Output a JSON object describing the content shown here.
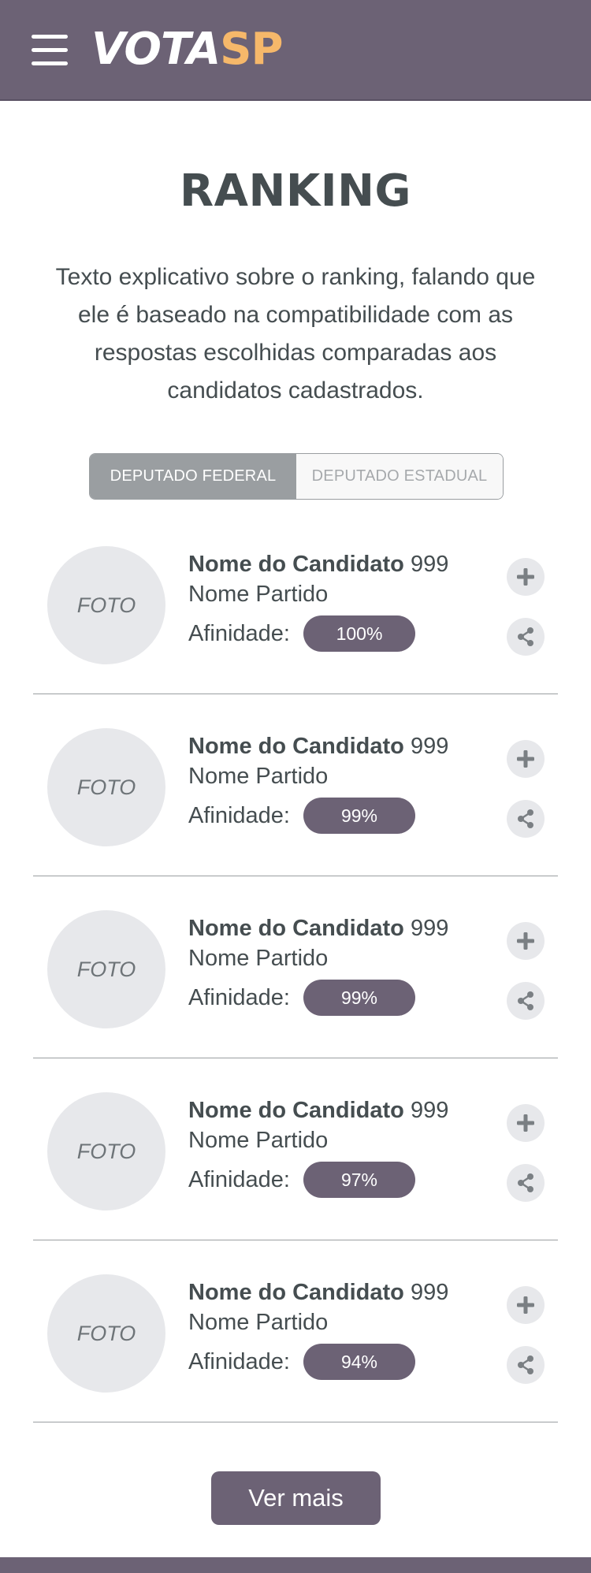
{
  "header": {
    "menu_icon": "hamburger-menu-icon",
    "logo_part1": "VOTA",
    "logo_part2": "SP",
    "colors": {
      "brand": "#6c6275",
      "accent": "#f6b86a"
    }
  },
  "page": {
    "title": "RANKING",
    "intro": "Texto explicativo sobre o ranking, falando que ele é baseado na compatibilidade com as respostas escolhidas comparadas aos candidatos cadastrados."
  },
  "tabs": [
    {
      "label": "DEPUTADO FEDERAL",
      "active": true
    },
    {
      "label": "DEPUTADO ESTADUAL",
      "active": false
    }
  ],
  "candidates": [
    {
      "photo": "FOTO",
      "name": "Nome do Candidato",
      "number": "999",
      "party": "Nome Partido",
      "affinity_label": "Afinidade:",
      "affinity": "100%"
    },
    {
      "photo": "FOTO",
      "name": "Nome do Candidato",
      "number": "999",
      "party": "Nome Partido",
      "affinity_label": "Afinidade:",
      "affinity": "99%"
    },
    {
      "photo": "FOTO",
      "name": "Nome do Candidato",
      "number": "999",
      "party": "Nome Partido",
      "affinity_label": "Afinidade:",
      "affinity": "99%"
    },
    {
      "photo": "FOTO",
      "name": "Nome do Candidato",
      "number": "999",
      "party": "Nome Partido",
      "affinity_label": "Afinidade:",
      "affinity": "97%"
    },
    {
      "photo": "FOTO",
      "name": "Nome do Candidato",
      "number": "999",
      "party": "Nome Partido",
      "affinity_label": "Afinidade:",
      "affinity": "94%"
    }
  ],
  "actions": {
    "add_icon": "plus-icon",
    "share_icon": "share-icon",
    "see_more": "Ver mais"
  }
}
